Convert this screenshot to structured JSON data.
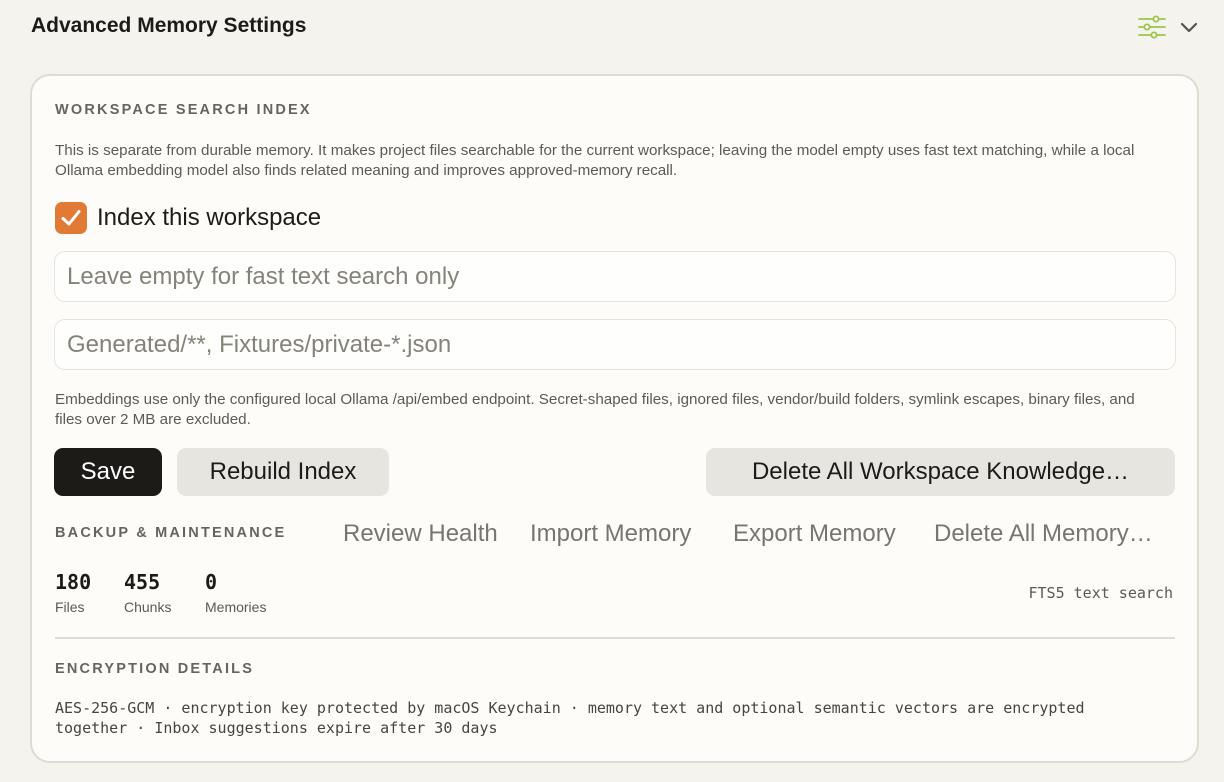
{
  "header": {
    "title": "Advanced Memory Settings",
    "icons": [
      "sliders-icon",
      "chevron-down-icon"
    ],
    "accent_color": "#9cc44a"
  },
  "search_index": {
    "label": "WORKSPACE SEARCH INDEX",
    "description": "This is separate from durable memory. It makes project files searchable for the current workspace; leaving the model empty uses fast text matching, while a local Ollama embedding model also finds related meaning and improves approved-memory recall.",
    "checkbox_label": "Index this workspace",
    "checkbox_checked": true,
    "checkbox_color": "#e07a34",
    "model_input": {
      "value": "",
      "placeholder": "Leave empty for fast text search only"
    },
    "exclude_input": {
      "value": "",
      "placeholder": "Generated/**, Fixtures/private-*.json"
    },
    "note": "Embeddings use only the configured local Ollama /api/embed endpoint. Secret-shaped files, ignored files, vendor/build folders, symlink escapes, binary files, and files over 2 MB are excluded.",
    "buttons": {
      "save": "Save",
      "rebuild": "Rebuild Index",
      "delete_knowledge": "Delete All Workspace Knowledge…"
    }
  },
  "backup": {
    "label": "BACKUP & MAINTENANCE",
    "actions": {
      "review": "Review Health",
      "import": "Import Memory",
      "export": "Export Memory",
      "delete": "Delete All Memory…"
    }
  },
  "stats": {
    "files": {
      "value": "180",
      "label": "Files"
    },
    "chunks": {
      "value": "455",
      "label": "Chunks"
    },
    "memories": {
      "value": "0",
      "label": "Memories"
    },
    "mode": "FTS5 text search"
  },
  "encryption": {
    "label": "ENCRYPTION DETAILS",
    "details": "AES-256-GCM · encryption key protected by macOS Keychain · memory text and optional semantic vectors are encrypted together · Inbox suggestions expire after 30 days"
  }
}
